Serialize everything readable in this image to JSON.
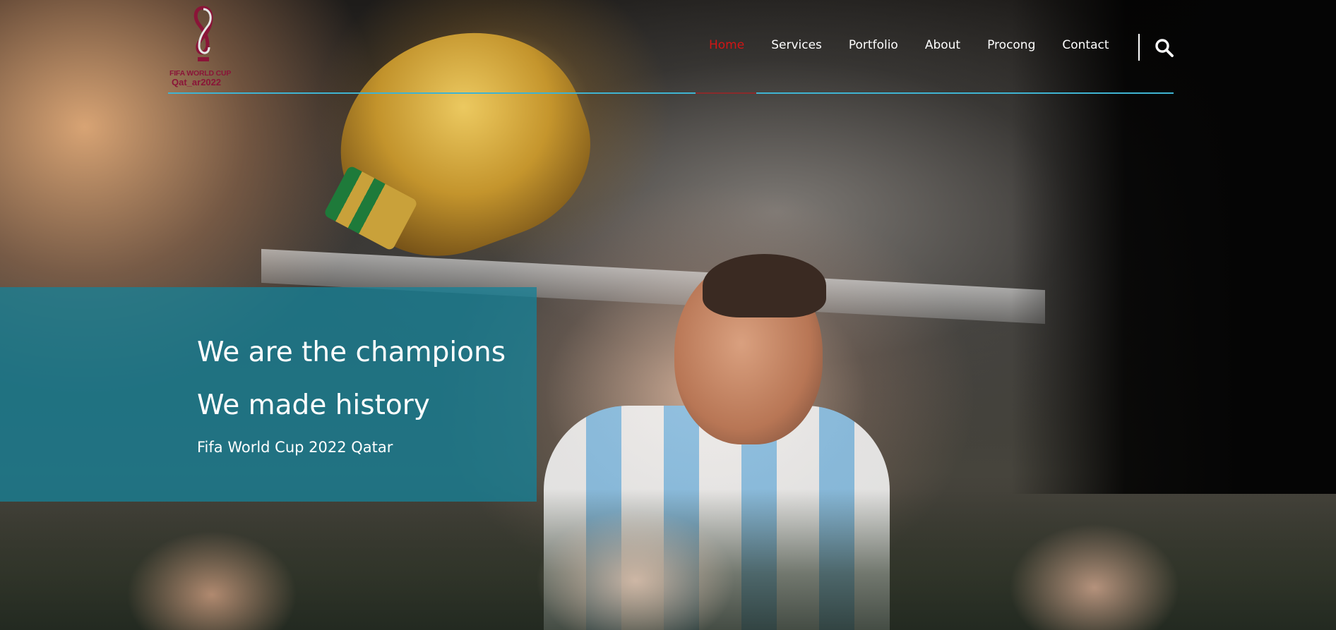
{
  "header": {
    "logo": {
      "line1": "FIFA WORLD CUP",
      "line2": "Qat_ar2022",
      "icon": "world-cup-emblem"
    },
    "nav": [
      {
        "label": "Home",
        "active": true
      },
      {
        "label": "Services",
        "active": false
      },
      {
        "label": "Portfolio",
        "active": false
      },
      {
        "label": "About",
        "active": false
      },
      {
        "label": "Procong",
        "active": false
      },
      {
        "label": "Contact",
        "active": false
      }
    ],
    "search_icon": "search-icon"
  },
  "hero": {
    "title": "We are the champions",
    "subtitle": "We made history",
    "tagline": "Fifa World Cup 2022 Qatar"
  },
  "colors": {
    "accent_line": "#3fb4d2",
    "active_nav": "#d11515",
    "caption_bg": "#178096",
    "logo": "#8a1538"
  }
}
